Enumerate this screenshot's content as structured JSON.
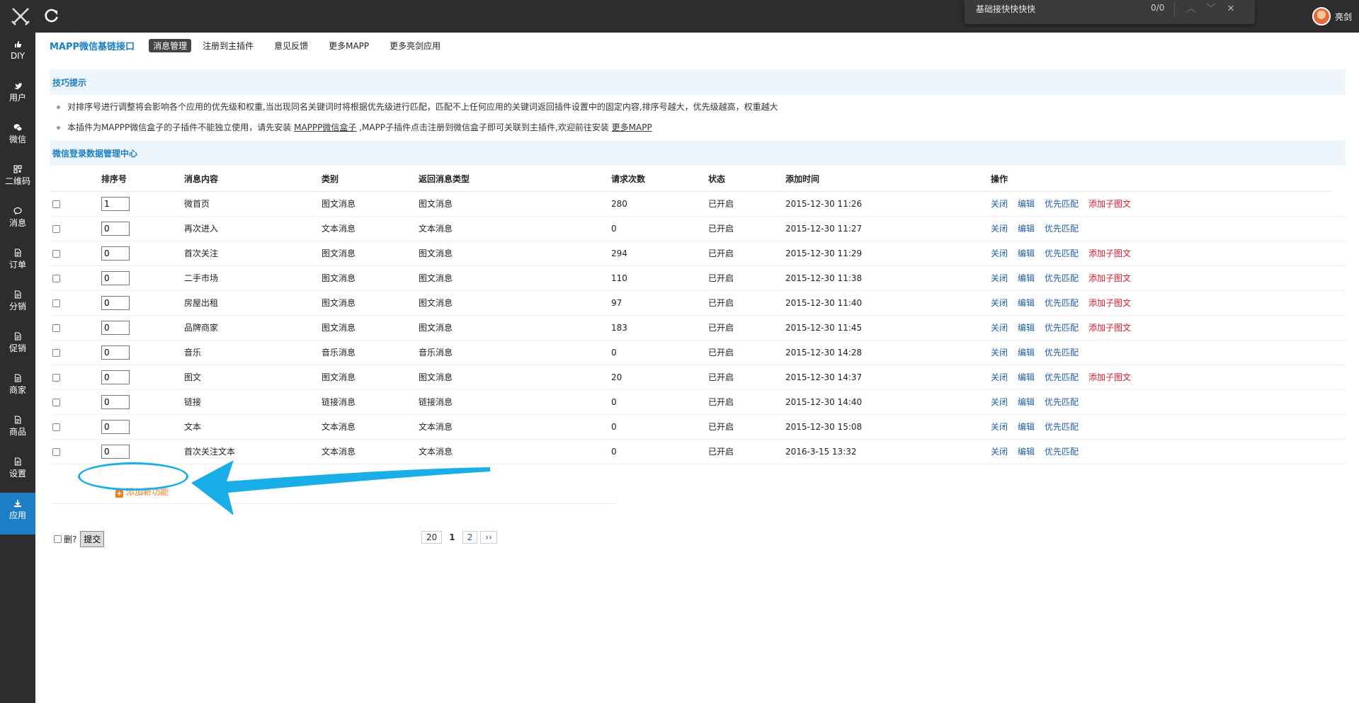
{
  "findbar": {
    "query": "基础接快快快快",
    "count": "0/0"
  },
  "user": {
    "name": "亮剑"
  },
  "sidebar": [
    {
      "label": "DIY",
      "icon": "thumbs-up-icon"
    },
    {
      "label": "用户",
      "icon": "twitter-icon"
    },
    {
      "label": "微信",
      "icon": "wechat-icon"
    },
    {
      "label": "二维码",
      "icon": "qrcode-icon"
    },
    {
      "label": "消息",
      "icon": "comment-icon"
    },
    {
      "label": "订单",
      "icon": "document-icon"
    },
    {
      "label": "分销",
      "icon": "document-icon"
    },
    {
      "label": "促销",
      "icon": "document-icon"
    },
    {
      "label": "商家",
      "icon": "document-icon"
    },
    {
      "label": "商品",
      "icon": "document-icon"
    },
    {
      "label": "设置",
      "icon": "document-icon"
    },
    {
      "label": "应用",
      "icon": "download-icon",
      "active": true
    }
  ],
  "nav": {
    "title": "MAPP微信基链接口",
    "tabs": [
      "消息管理",
      "注册到主插件",
      "意见反馈",
      "更多MAPP",
      "更多亮剑应用"
    ]
  },
  "tips": {
    "title": "技巧提示",
    "line1": "对排序号进行调整将会影响各个应用的优先级和权重,当出现同名关键词时将根据优先级进行匹配，匹配不上任何应用的关键词返回插件设置中的固定内容,排序号越大，优先级越高，权重越大",
    "line2_a": "本插件为MAPPP微信盒子的子插件不能独立使用，请先安装 ",
    "line2_link1": "MAPPP微信盒子",
    "line2_b": " ,MAPP子插件点击注册到微信盒子即可关联到主插件,欢迎前往安装 ",
    "line2_link2": "更多MAPP"
  },
  "grid": {
    "title": "微信登录数据管理中心",
    "headers": [
      "排序号",
      "消息内容",
      "类别",
      "返回消息类型",
      "请求次数",
      "状态",
      "添加时间",
      "操作"
    ],
    "actions": {
      "close": "关闭",
      "edit": "编辑",
      "priority": "优先匹配",
      "add_sub": "添加子图文"
    },
    "rows": [
      {
        "order": "1",
        "content": "微首页",
        "category": "图文消息",
        "return_type": "图文消息",
        "requests": "280",
        "status": "已开启",
        "time": "2015-12-30 11:26",
        "has_sub": true
      },
      {
        "order": "0",
        "content": "再次进入",
        "category": "文本消息",
        "return_type": "文本消息",
        "requests": "0",
        "status": "已开启",
        "time": "2015-12-30 11:27",
        "has_sub": false
      },
      {
        "order": "0",
        "content": "首次关注",
        "category": "图文消息",
        "return_type": "图文消息",
        "requests": "294",
        "status": "已开启",
        "time": "2015-12-30 11:29",
        "has_sub": true
      },
      {
        "order": "0",
        "content": "二手市场",
        "category": "图文消息",
        "return_type": "图文消息",
        "requests": "110",
        "status": "已开启",
        "time": "2015-12-30 11:38",
        "has_sub": true
      },
      {
        "order": "0",
        "content": "房屋出租",
        "category": "图文消息",
        "return_type": "图文消息",
        "requests": "97",
        "status": "已开启",
        "time": "2015-12-30 11:40",
        "has_sub": true
      },
      {
        "order": "0",
        "content": "品牌商家",
        "category": "图文消息",
        "return_type": "图文消息",
        "requests": "183",
        "status": "已开启",
        "time": "2015-12-30 11:45",
        "has_sub": true
      },
      {
        "order": "0",
        "content": "音乐",
        "category": "音乐消息",
        "return_type": "音乐消息",
        "requests": "0",
        "status": "已开启",
        "time": "2015-12-30 14:28",
        "has_sub": false
      },
      {
        "order": "0",
        "content": "图文",
        "category": "图文消息",
        "return_type": "图文消息",
        "requests": "20",
        "status": "已开启",
        "time": "2015-12-30 14:37",
        "has_sub": true
      },
      {
        "order": "0",
        "content": "链接",
        "category": "链接消息",
        "return_type": "链接消息",
        "requests": "0",
        "status": "已开启",
        "time": "2015-12-30 14:40",
        "has_sub": false
      },
      {
        "order": "0",
        "content": "文本",
        "category": "文本消息",
        "return_type": "文本消息",
        "requests": "0",
        "status": "已开启",
        "time": "2015-12-30 15:08",
        "has_sub": false
      },
      {
        "order": "0",
        "content": "首次关注文本",
        "category": "文本消息",
        "return_type": "文本消息",
        "requests": "0",
        "status": "已开启",
        "time": "2016-3-15 13:32",
        "has_sub": false
      }
    ],
    "add_label": "添加新功能"
  },
  "footer": {
    "delete_label": "删?",
    "submit_label": "提交",
    "pager": [
      "20",
      "1",
      "2",
      "››"
    ]
  },
  "colors": {
    "accent": "#1c7fc6",
    "annotation": "#1aaee8",
    "danger": "#e0192a",
    "add": "#ef7d1a"
  }
}
